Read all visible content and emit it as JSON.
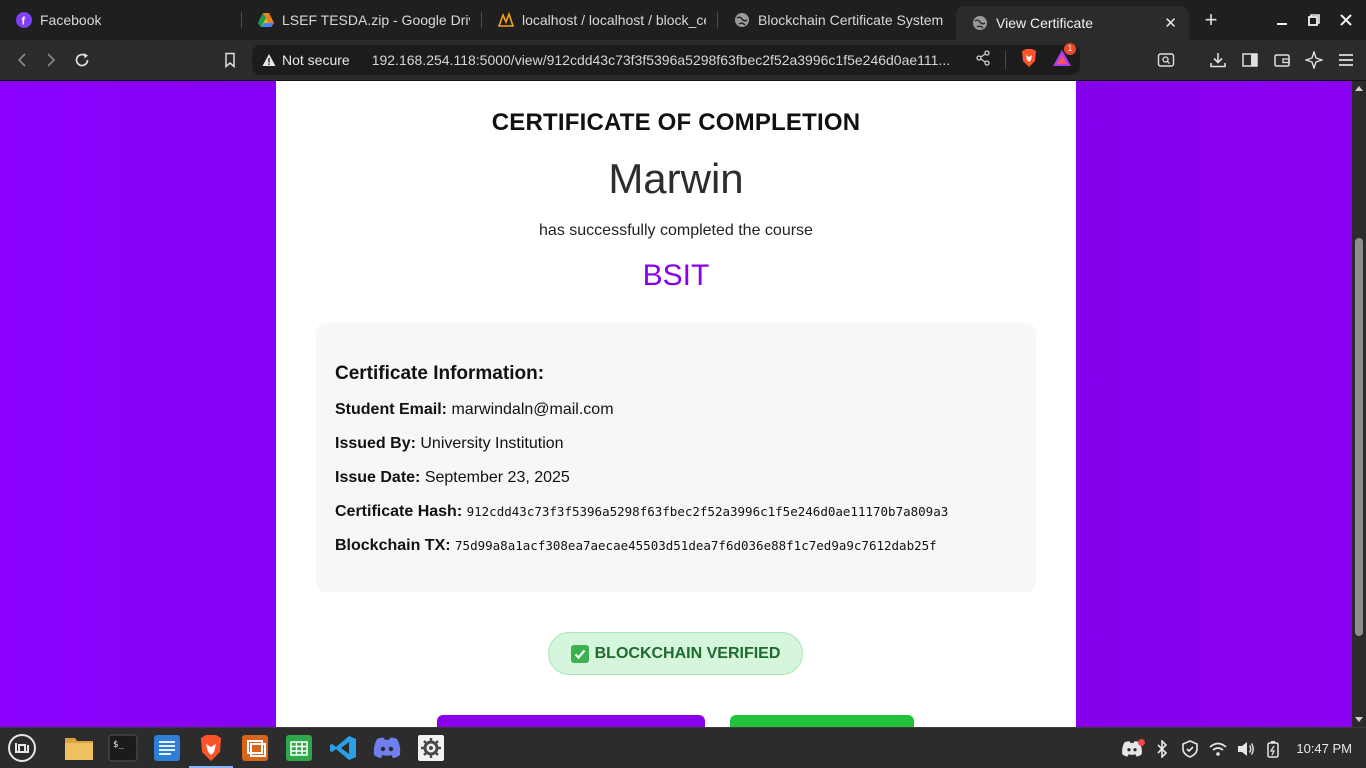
{
  "browser": {
    "tabs": [
      {
        "title": "Facebook",
        "icon": "facebook-icon",
        "active": false
      },
      {
        "title": "LSEF TESDA.zip - Google Drive",
        "icon": "google-drive-icon",
        "active": false
      },
      {
        "title": "localhost / localhost / block_cert",
        "icon": "phpmyadmin-icon",
        "active": false
      },
      {
        "title": "Blockchain Certificate System",
        "icon": "globe-icon",
        "active": false
      },
      {
        "title": "View Certificate",
        "icon": "globe-icon",
        "active": true
      }
    ],
    "address_bar": {
      "security_label": "Not secure",
      "url": "192.168.254.118:5000/view/912cdd43c73f3f5396a5298f63fbec2f52a3996c1f5e246d0ae111..."
    },
    "notification_count": "1"
  },
  "certificate": {
    "title": "CERTIFICATE OF COMPLETION",
    "student_name": "Marwin",
    "completed_text": "has successfully completed the course",
    "course": "BSIT",
    "info": {
      "heading": "Certificate Information:",
      "rows": [
        {
          "label": "Student Email:",
          "value": "marwindaln@mail.com",
          "mono": false
        },
        {
          "label": "Issued By:",
          "value": "University Institution",
          "mono": false
        },
        {
          "label": "Issue Date:",
          "value": "September 23, 2025",
          "mono": false
        },
        {
          "label": "Certificate Hash:",
          "value": "912cdd43c73f3f5396a5298f63fbec2f52a3996c1f5e246d0ae11170b7a809a3",
          "mono": true
        },
        {
          "label": "Blockchain TX:",
          "value": "75d99a8a1acf308ea7aecae45503d51dea7f6d036e88f1c7ed9a9c7612dab25f",
          "mono": true
        }
      ]
    },
    "verified_badge": "BLOCKCHAIN VERIFIED"
  },
  "taskbar": {
    "apps": [
      "menu-icon",
      "files-icon",
      "terminal-icon",
      "text-editor-icon",
      "brave-browser-icon",
      "slides-icon",
      "spreadsheet-icon",
      "vscode-icon",
      "discord-icon",
      "settings-icon"
    ],
    "clock": "10:47 PM"
  },
  "colors": {
    "page_background": "#8b00ff",
    "course_accent": "#8a00ea",
    "verified_green": "#1f6b2d",
    "button_green": "#22c33b"
  }
}
